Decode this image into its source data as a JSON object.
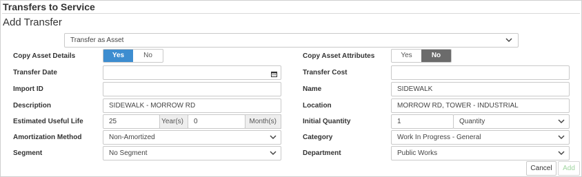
{
  "header": {
    "title": "Transfers to Service",
    "subtitle": "Add Transfer"
  },
  "transfer_type": {
    "value": "Transfer as Asset",
    "icon": "chevron-down-icon"
  },
  "left": {
    "copy_asset_details": {
      "label": "Copy Asset Details",
      "yes": "Yes",
      "no": "No",
      "selected": "Yes"
    },
    "transfer_date": {
      "label": "Transfer Date",
      "value": "",
      "icon": "calendar-icon"
    },
    "import_id": {
      "label": "Import ID",
      "value": ""
    },
    "description": {
      "label": "Description",
      "value": "SIDEWALK - MORROW RD"
    },
    "useful_life": {
      "label": "Estimated Useful Life",
      "years_value": "25",
      "years_unit": "Year(s)",
      "months_value": "0",
      "months_unit": "Month(s)"
    },
    "amortization_method": {
      "label": "Amortization Method",
      "value": "Non-Amortized"
    },
    "segment": {
      "label": "Segment",
      "value": "No Segment"
    }
  },
  "right": {
    "copy_asset_attributes": {
      "label": "Copy Asset Attributes",
      "yes": "Yes",
      "no": "No",
      "selected": "No"
    },
    "transfer_cost": {
      "label": "Transfer Cost",
      "value": ""
    },
    "name": {
      "label": "Name",
      "value": "SIDEWALK"
    },
    "location": {
      "label": "Location",
      "value": "MORROW RD, TOWER - INDUSTRIAL"
    },
    "initial_quantity": {
      "label": "Initial Quantity",
      "value": "1",
      "unit": "Quantity"
    },
    "category": {
      "label": "Category",
      "value": "Work In Progress - General"
    },
    "department": {
      "label": "Department",
      "value": "Public Works"
    }
  },
  "actions": {
    "cancel_label": "Cancel",
    "add_label": "Add"
  },
  "colors": {
    "yes_active": "#3d8dd0",
    "no_active": "#6b6b6b",
    "add_disabled_text": "#9fd49f"
  }
}
